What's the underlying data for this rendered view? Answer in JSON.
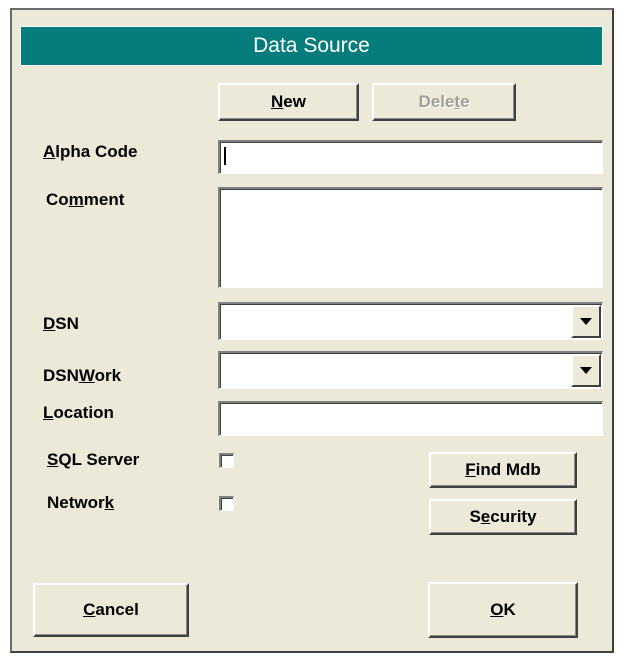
{
  "dialog": {
    "title": "Data Source"
  },
  "buttons": {
    "new": {
      "pre": "",
      "key": "N",
      "post": "ew"
    },
    "delete": {
      "pre": "Dele",
      "key": "t",
      "post": "e"
    },
    "find_mdb": {
      "pre": "",
      "key": "F",
      "post": "ind Mdb"
    },
    "security": {
      "pre": "S",
      "key": "e",
      "post": "curity"
    },
    "cancel": {
      "pre": "",
      "key": "C",
      "post": "ancel"
    },
    "ok": {
      "pre": "",
      "key": "O",
      "post": "K"
    }
  },
  "fields": {
    "alpha_code": {
      "label_pre": "",
      "label_key": "A",
      "label_post": "lpha Code",
      "value": ""
    },
    "comment": {
      "label_pre": "Co",
      "label_key": "m",
      "label_post": "ment",
      "value": ""
    },
    "dsn": {
      "label_pre": "",
      "label_key": "D",
      "label_post": "SN",
      "value": ""
    },
    "dsnwork": {
      "label_pre": "DSN",
      "label_key": "W",
      "label_post": "ork",
      "value": ""
    },
    "location": {
      "label_pre": "",
      "label_key": "L",
      "label_post": "ocation",
      "value": ""
    },
    "sql_server": {
      "label_pre": "",
      "label_key": "S",
      "label_post": "QL Server",
      "checked": false
    },
    "network": {
      "label_pre": "Networ",
      "label_key": "k",
      "label_post": "",
      "checked": false
    }
  },
  "icons": {
    "combo_arrow": "chevron-down-icon"
  },
  "colors": {
    "title_bar": "#067c7c",
    "dialog_bg": "#ece9d8"
  }
}
